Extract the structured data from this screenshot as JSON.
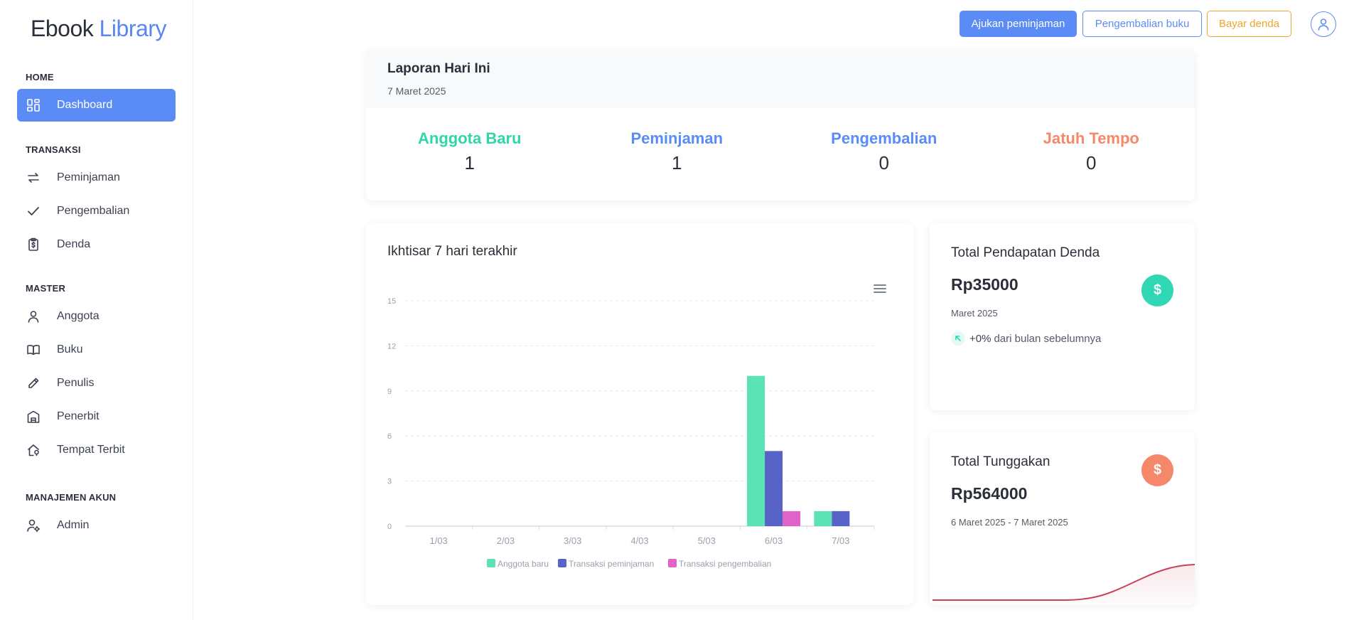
{
  "brand": {
    "part1": "Ebook",
    "part2": "Library"
  },
  "sidebar": {
    "sections": {
      "home": "HOME",
      "transaksi": "TRANSAKSI",
      "master": "MASTER",
      "akun": "MANAJEMEN AKUN"
    },
    "items": {
      "dashboard": "Dashboard",
      "peminjaman": "Peminjaman",
      "pengembalian": "Pengembalian",
      "denda": "Denda",
      "anggota": "Anggota",
      "buku": "Buku",
      "penulis": "Penulis",
      "penerbit": "Penerbit",
      "tempat_terbit": "Tempat Terbit",
      "admin": "Admin"
    }
  },
  "header": {
    "btn_pinjam": "Ajukan peminjaman",
    "btn_kembali": "Pengembalian buku",
    "btn_denda": "Bayar denda"
  },
  "report": {
    "title": "Laporan Hari Ini",
    "date": "7 Maret 2025",
    "stats": [
      {
        "label": "Anggota Baru",
        "value": "1",
        "color": "#2fd7a8"
      },
      {
        "label": "Peminjaman",
        "value": "1",
        "color": "#5b8cf6"
      },
      {
        "label": "Pengembalian",
        "value": "0",
        "color": "#5b8cf6"
      },
      {
        "label": "Jatuh Tempo",
        "value": "0",
        "color": "#f5876a"
      }
    ]
  },
  "chart_card": {
    "title": "Ikhtisar 7 hari terakhir"
  },
  "chart_data": {
    "type": "bar",
    "categories": [
      "1/03",
      "2/03",
      "3/03",
      "4/03",
      "5/03",
      "6/03",
      "7/03"
    ],
    "series": [
      {
        "name": "Anggota baru",
        "color": "#5ce3b5",
        "values": [
          0,
          0,
          0,
          0,
          0,
          10,
          1
        ]
      },
      {
        "name": "Transaksi peminjaman",
        "color": "#5863c8",
        "values": [
          0,
          0,
          0,
          0,
          0,
          5,
          1
        ]
      },
      {
        "name": "Transaksi pengembalian",
        "color": "#e063c8",
        "values": [
          0,
          0,
          0,
          0,
          0,
          1,
          0
        ]
      }
    ],
    "yticks": [
      "0",
      "3",
      "6",
      "9",
      "12",
      "15"
    ],
    "ylim": [
      0,
      15
    ],
    "grid": true,
    "legend": "bottom"
  },
  "fine": {
    "title": "Total Pendapatan Denda",
    "value": "Rp35000",
    "period": "Maret 2025",
    "pct": "+0%",
    "pct_text": "dari bulan sebelumnya",
    "icon": "$",
    "color": "#2fd7b4"
  },
  "arrears": {
    "title": "Total Tunggakan",
    "value": "Rp564000",
    "period": "6 Maret 2025 - 7 Maret 2025",
    "icon": "$",
    "color": "#f5876a"
  }
}
